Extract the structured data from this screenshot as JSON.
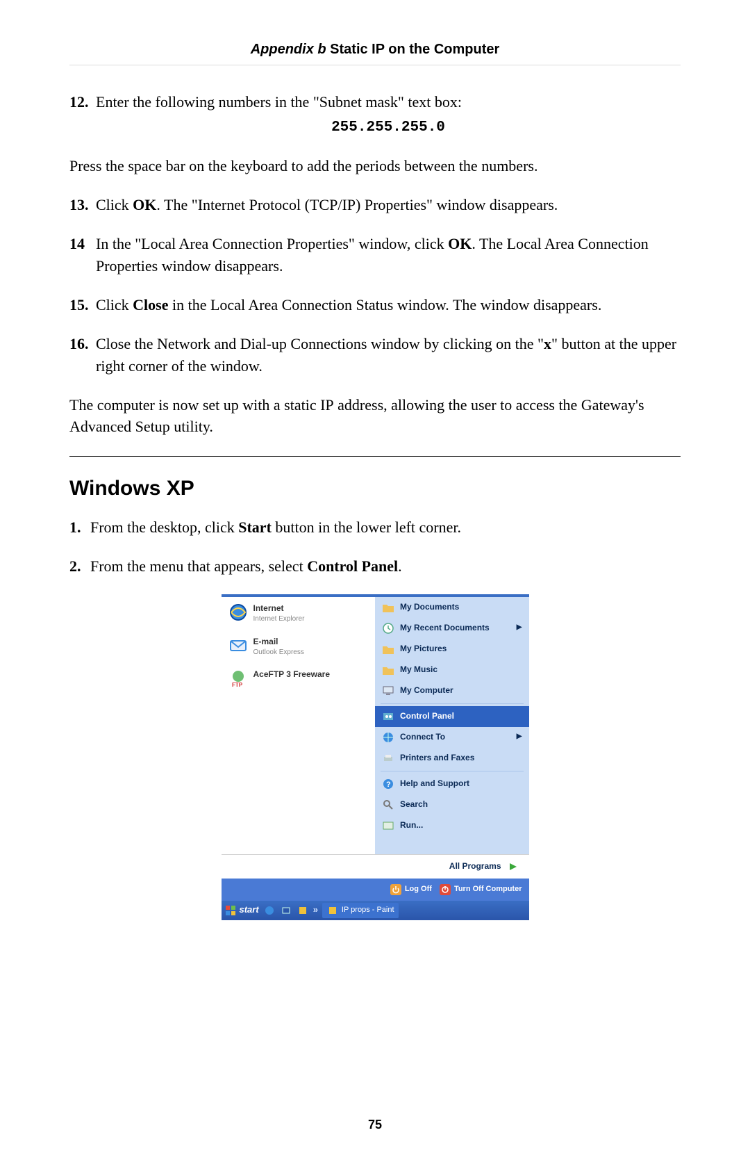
{
  "header": {
    "appendix": "Appendix b",
    "title": " Static IP on the Computer"
  },
  "steps": {
    "s12": {
      "num": "12.",
      "text_a": "Enter the following numbers in the \"Subnet mask\" text box:",
      "code": "255.255.255.0"
    },
    "press": "Press the space bar on the keyboard to add the periods between the numbers.",
    "s13": {
      "num": "13.",
      "t1": "Click ",
      "ok": "OK",
      "t2": ". The \"Internet Protocol (",
      "tcpip": "TCP/IP",
      "t3": ") Properties\" window disappears."
    },
    "s14": {
      "num": "14",
      "t1": "In the \"Local Area Connection Properties\" window, click ",
      "ok": "OK",
      "t2": ". The Local Area Connection Properties window disappears."
    },
    "s15": {
      "num": "15.",
      "t1": "Click ",
      "close": "Close",
      "t2": " in the Local Area Connection Status window. The window disappears."
    },
    "s16": {
      "num": "16.",
      "t1": "Close the Network and Dial-up Connections window by clicking on the \"",
      "x": "x",
      "t2": "\" button at the upper right corner of the window."
    },
    "outro1": "The computer is now set up with a static ",
    "ip": "IP",
    "outro2": " address, allowing the user to access the Gateway's Advanced Setup utility."
  },
  "xp": {
    "heading": "Windows XP",
    "s1": {
      "num": "1.",
      "t1": "From the desktop, click ",
      "start": "Start",
      "t2": " button in the lower left corner."
    },
    "s2": {
      "num": "2.",
      "t1": "From the menu that appears, select ",
      "cp": "Control Panel",
      "t2": "."
    }
  },
  "startmenu": {
    "left": {
      "internet": {
        "title": "Internet",
        "sub": "Internet Explorer"
      },
      "email": {
        "title": "E-mail",
        "sub": "Outlook Express"
      },
      "ace": "AceFTP 3 Freeware",
      "all": "All Programs"
    },
    "right": {
      "docs": "My Documents",
      "recent": "My Recent Documents",
      "pics": "My Pictures",
      "music": "My Music",
      "comp": "My Computer",
      "cpanel": "Control Panel",
      "connect": "Connect To",
      "printers": "Printers and Faxes",
      "help": "Help and Support",
      "search": "Search",
      "run": "Run..."
    },
    "logoff": "Log Off",
    "shutdown": "Turn Off Computer",
    "taskbar": {
      "start": "start",
      "chev": "»",
      "task": "IP props - Paint"
    }
  },
  "page_number": "75"
}
